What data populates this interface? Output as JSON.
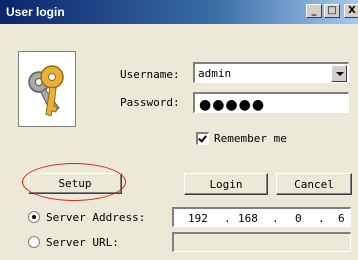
{
  "window": {
    "title": "User login",
    "controls": {
      "minimize": "_",
      "maximize": "□",
      "close": "X"
    }
  },
  "icon": {
    "name": "keys-icon"
  },
  "form": {
    "username_label": "Username:",
    "username_value": "admin",
    "password_label": "Password:",
    "password_value": "●●●●●",
    "remember_label": "Remember me",
    "remember_checked": true
  },
  "buttons": {
    "setup": "Setup",
    "login": "Login",
    "cancel": "Cancel"
  },
  "server": {
    "address_label": "Server Address:",
    "address_selected": true,
    "ip": [
      "192",
      "168",
      "0",
      "6"
    ],
    "ip_separator": ".",
    "url_label": "Server URL:",
    "url_value": ""
  },
  "colors": {
    "title_gradient_start": "#0A246A",
    "window_bg": "#ECE9D8",
    "highlight_ellipse": "#E02020"
  }
}
